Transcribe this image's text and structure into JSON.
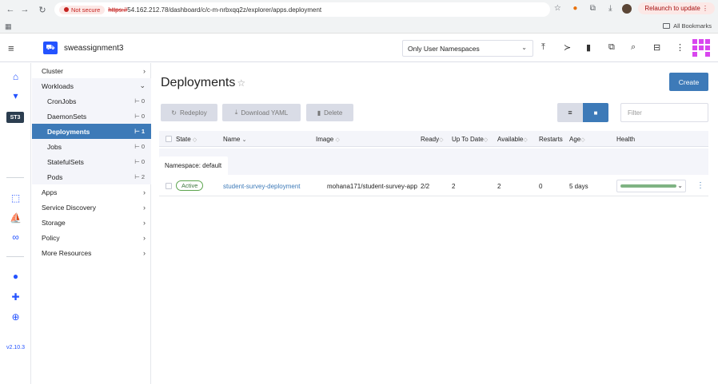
{
  "browser": {
    "not_secure": "Not secure",
    "url_scheme": "https://",
    "url_rest": "54.162.212.78/dashboard/c/c-m-nrbxqq2z/explorer/apps.deployment",
    "relaunch": "Relaunch to update",
    "all_bookmarks": "All Bookmarks"
  },
  "header": {
    "cluster_name": "sweassignment3",
    "namespace_filter": "Only User Namespaces"
  },
  "rail": {
    "cluster_badge": "ST3",
    "version": "v2.10.3"
  },
  "sidenav": {
    "cluster": "Cluster",
    "workloads": "Workloads",
    "items": [
      {
        "label": "CronJobs",
        "count": "0"
      },
      {
        "label": "DaemonSets",
        "count": "0"
      },
      {
        "label": "Deployments",
        "count": "1"
      },
      {
        "label": "Jobs",
        "count": "0"
      },
      {
        "label": "StatefulSets",
        "count": "0"
      },
      {
        "label": "Pods",
        "count": "2"
      }
    ],
    "groups": [
      "Apps",
      "Service Discovery",
      "Storage",
      "Policy",
      "More Resources"
    ]
  },
  "main": {
    "title": "Deployments",
    "create": "Create",
    "redeploy": "Redeploy",
    "download_yaml": "Download YAML",
    "delete": "Delete",
    "filter_placeholder": "Filter",
    "columns": [
      "State",
      "Name",
      "Image",
      "Ready",
      "Up To Date",
      "Available",
      "Restarts",
      "Age",
      "Health"
    ],
    "group_label": "Namespace: default",
    "row": {
      "state": "Active",
      "name": "student-survey-deployment",
      "image": "mohana171/student-survey-app",
      "ready": "2/2",
      "up_to_date": "2",
      "available": "2",
      "restarts": "0",
      "age": "5 days"
    }
  },
  "colors": {
    "accent": "#3d7ab8",
    "brand": "#2453ff",
    "active_green": "#5da54f"
  }
}
